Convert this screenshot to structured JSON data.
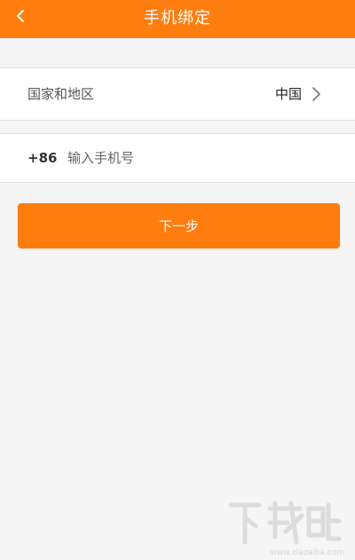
{
  "header": {
    "title": "手机绑定",
    "back_icon": "chevron-left-icon",
    "background": "#ff7d0f"
  },
  "region": {
    "label": "国家和地区",
    "value": "中国",
    "arrow_icon": "chevron-right-icon"
  },
  "phone": {
    "prefix": "+86",
    "placeholder": "输入手机号",
    "value": ""
  },
  "actions": {
    "next_label": "下一步",
    "color": "#ff7d0f"
  },
  "watermark": {
    "brand": "下载吧",
    "url": "www.xiazaiba.com"
  }
}
